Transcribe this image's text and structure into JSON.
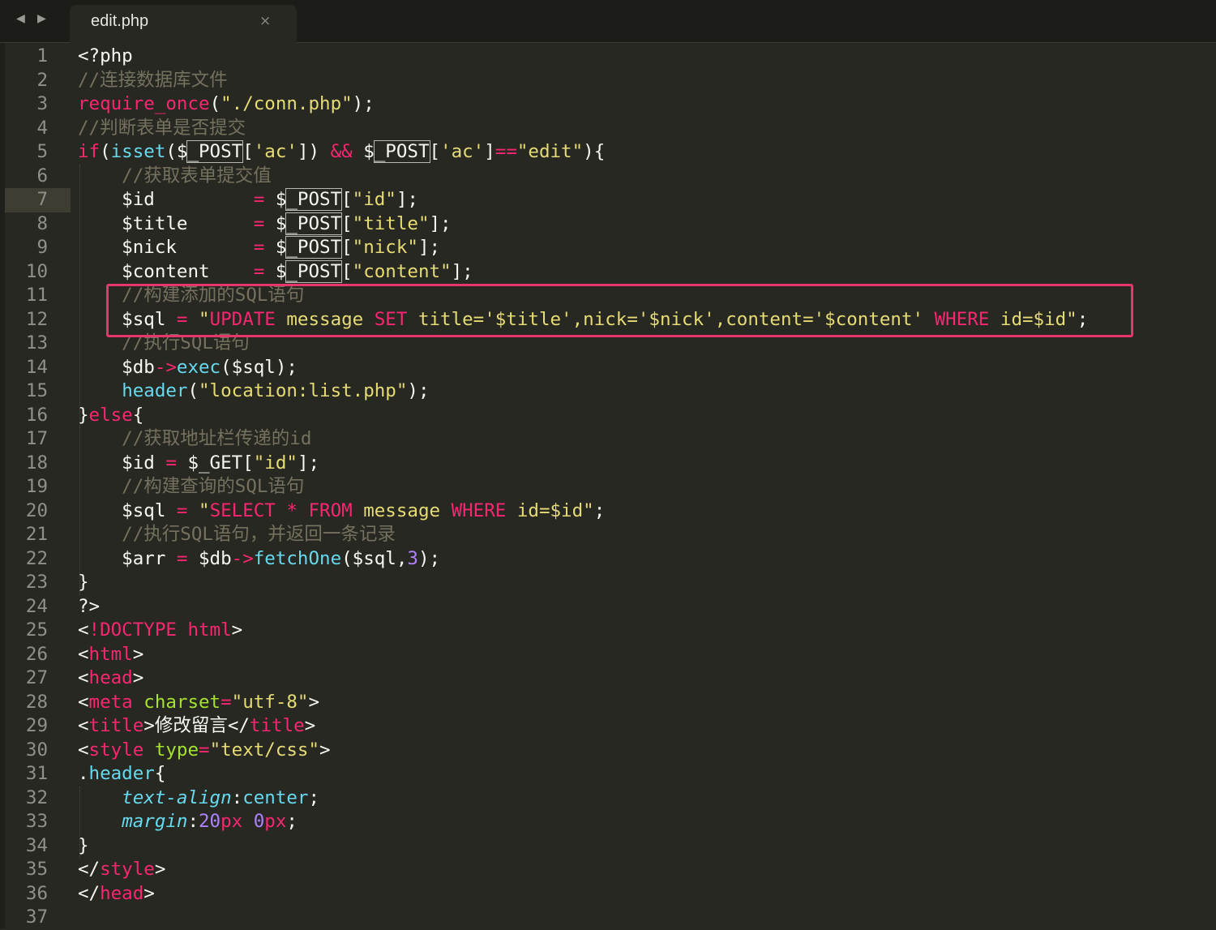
{
  "tab": {
    "title": "edit.php",
    "close_glyph": "×",
    "back_glyph": "◀",
    "forward_glyph": "▶"
  },
  "colors": {
    "background": "#272822",
    "highlight_box": "#e8356b",
    "keyword": "#f92672",
    "string": "#e6db74",
    "comment": "#75715e",
    "function": "#66d9ef",
    "number": "#ae81ff",
    "attribute": "#a6e22e"
  },
  "current_line": 7,
  "lines": [
    {
      "n": "1",
      "t": "<?php"
    },
    {
      "n": "2",
      "t": "//连接数据库文件"
    },
    {
      "n": "3",
      "t": "require_once(\"./conn.php\");"
    },
    {
      "n": "4",
      "t": "//判断表单是否提交"
    },
    {
      "n": "5",
      "t": "if(isset($_POST['ac']) && $_POST['ac']==\"edit\"){"
    },
    {
      "n": "6",
      "t": "    //获取表单提交值"
    },
    {
      "n": "7",
      "t": "    $id         = $_POST[\"id\"];"
    },
    {
      "n": "8",
      "t": "    $title      = $_POST[\"title\"];"
    },
    {
      "n": "9",
      "t": "    $nick       = $_POST[\"nick\"];"
    },
    {
      "n": "10",
      "t": "    $content    = $_POST[\"content\"];"
    },
    {
      "n": "11",
      "t": "    //构建添加的SQL语句"
    },
    {
      "n": "12",
      "t": "    $sql = \"UPDATE message SET title='$title',nick='$nick',content='$content' WHERE id=$id\";"
    },
    {
      "n": "13",
      "t": "    //执行SQL语句"
    },
    {
      "n": "14",
      "t": "    $db->exec($sql);"
    },
    {
      "n": "15",
      "t": "    header(\"location:list.php\");"
    },
    {
      "n": "16",
      "t": "}else{"
    },
    {
      "n": "17",
      "t": "    //获取地址栏传递的id"
    },
    {
      "n": "18",
      "t": "    $id = $_GET[\"id\"];"
    },
    {
      "n": "19",
      "t": "    //构建查询的SQL语句"
    },
    {
      "n": "20",
      "t": "    $sql = \"SELECT * FROM message WHERE id=$id\";"
    },
    {
      "n": "21",
      "t": "    //执行SQL语句，并返回一条记录"
    },
    {
      "n": "22",
      "t": "    $arr = $db->fetchOne($sql,3);"
    },
    {
      "n": "23",
      "t": "}"
    },
    {
      "n": "24",
      "t": "?>"
    },
    {
      "n": "25",
      "t": "<!DOCTYPE html>"
    },
    {
      "n": "26",
      "t": "<html>"
    },
    {
      "n": "27",
      "t": "<head>"
    },
    {
      "n": "28",
      "t": "<meta charset=\"utf-8\">"
    },
    {
      "n": "29",
      "t": "<title>修改留言</title>"
    },
    {
      "n": "30",
      "t": "<style type=\"text/css\">"
    },
    {
      "n": "31",
      "t": ".header{"
    },
    {
      "n": "32",
      "t": "    text-align:center;"
    },
    {
      "n": "33",
      "t": "    margin:20px 0px;"
    },
    {
      "n": "34",
      "t": "}"
    },
    {
      "n": "35",
      "t": "</style>"
    },
    {
      "n": "36",
      "t": "</head>"
    },
    {
      "n": "37",
      "t": ""
    }
  ]
}
